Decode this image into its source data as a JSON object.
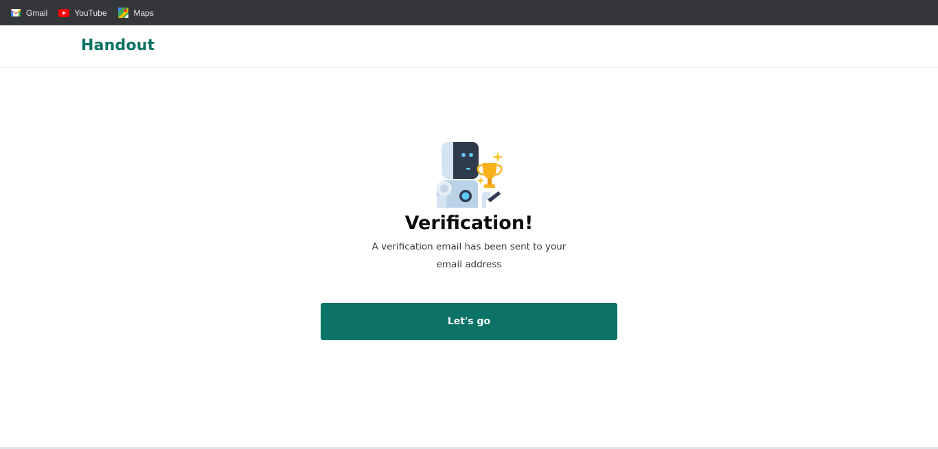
{
  "bookmarks": [
    {
      "label": "Gmail",
      "icon": "gmail-icon"
    },
    {
      "label": "YouTube",
      "icon": "youtube-icon"
    },
    {
      "label": "Maps",
      "icon": "maps-icon"
    }
  ],
  "header": {
    "brand": "Handout"
  },
  "main": {
    "illustration": "robot-trophy-icon",
    "title": "Verification!",
    "subtitle": "A verification email has been sent to your email address",
    "cta_label": "Let's go"
  },
  "colors": {
    "brand": "#0b7366",
    "bookmarks_bar": "#35363a"
  }
}
